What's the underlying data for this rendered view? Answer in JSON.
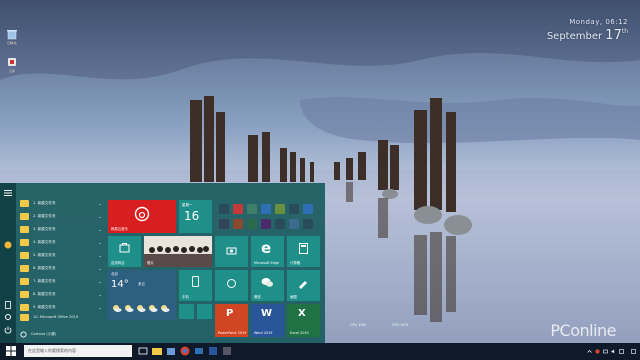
{
  "desktop": {
    "icons": [
      {
        "name": "recycle-bin-icon",
        "label": "回收站"
      },
      {
        "name": "app-icon",
        "label": "应用"
      }
    ]
  },
  "clock_widget": {
    "day_line": "Monday, 06:12",
    "date_month": "September",
    "date_day": "17",
    "date_suffix": "th"
  },
  "start_menu": {
    "app_list": [
      {
        "label": "1. 新建文件夹"
      },
      {
        "label": "2. 新建文件夹"
      },
      {
        "label": "3. 新建文件夹"
      },
      {
        "label": "4. 新建文件夹"
      },
      {
        "label": "5. 新建文件夹"
      },
      {
        "label": "6. 新建文件夹"
      },
      {
        "label": "7. 新建文件夹"
      },
      {
        "label": "8. 新建文件夹"
      },
      {
        "label": "9. 新建文件夹"
      },
      {
        "label": "10. Microsoft Office 2019"
      },
      {
        "label": "Cortana (小娜)"
      }
    ],
    "tiles": {
      "music": {
        "label": "网易云音乐"
      },
      "calendar": {
        "label": "星期一",
        "day": "16"
      },
      "store": {
        "label": "应用商店"
      },
      "photos": {
        "label": "照片"
      },
      "weather": {
        "label": "多云",
        "temp": "14°",
        "city": "北京"
      },
      "mobile": {
        "label": "手机"
      },
      "edge": {
        "label": "Microsoft Edge"
      },
      "calculator": {
        "label": "计算器"
      },
      "wechat": {
        "label": "微信"
      },
      "paint": {
        "label": "画图"
      },
      "powerpoint": {
        "label": "PowerPoint 2019"
      },
      "word": {
        "label": "Word 2019"
      },
      "excel": {
        "label": "Excel 2019"
      }
    }
  },
  "taskbar": {
    "search_placeholder": "在这里输入你要搜索的内容",
    "tray_time": "",
    "tray_date": ""
  },
  "monitor": {
    "cpu_label": "CPU",
    "cpu_value": "15%",
    "gpu_label": "GPU",
    "gpu_value": "41%"
  },
  "watermark": "PConline",
  "colors": {
    "start_bg": "#1c5c60",
    "tile_teal": "#1f8f8a",
    "tile_red": "#d81e1e",
    "folder": "#f3c94a",
    "taskbar": "#0e1a2a"
  }
}
